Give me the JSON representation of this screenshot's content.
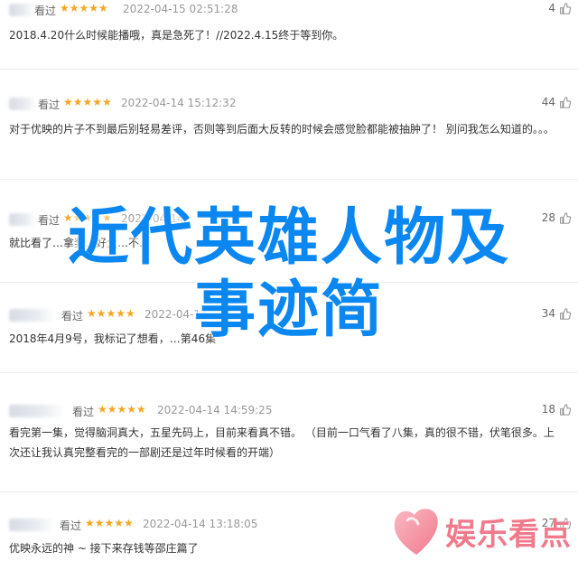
{
  "overlay": {
    "title_line1": "近代英雄人物及",
    "title_line2": "事迹简"
  },
  "watermark": {
    "logo_text": "娱乐看点",
    "logo_icon": "pink-heart-blob-icon",
    "color": "#f07a8c"
  },
  "reviews": [
    {
      "status": "看过",
      "stars": "★★★★★",
      "date": "2022-04-15 02:51:28",
      "likes": "4",
      "text": "2018.4.20什么时候能播哦，真是急死了！//2022.4.15终于等到你。"
    },
    {
      "status": "看过",
      "stars": "★★★★★",
      "date": "2022-04-14 15:12:32",
      "likes": "44",
      "text": "对于优映的片子不到最后别轻易差评，否则等到后面大反转的时候会感觉脸都能被抽肿了！ 别问我怎么知道的。。。"
    },
    {
      "status": "看过",
      "stars": "★★★★★",
      "date": "2022-04-14",
      "likes": "28",
      "text": "就比看了…拿奖…好大…不…"
    },
    {
      "status": "看过",
      "stars": "★★★★★",
      "date": "2022-04-14",
      "likes": "34",
      "text": "2018年4月9号，我标记了想看，…第46集"
    },
    {
      "status": "看过",
      "stars": "★★★★★",
      "date": "2022-04-14 14:59:25",
      "likes": "18",
      "text": "看完第一集，觉得脑洞真大，五星先码上，目前来看真不错。 （目前一口气看了八集，真的很不错，伏笔很多。上次还让我认真完整看完的一部剧还是过年时候看的开端）"
    },
    {
      "status": "看过",
      "stars": "★★★★★",
      "date": "2022-04-14 13:18:05",
      "likes": "27",
      "text": "优映永远的神 ~ 接下来存钱等邵庄篇了"
    }
  ],
  "accent_colors": {
    "stars": "#f5a623",
    "title": "#0a87f0"
  }
}
